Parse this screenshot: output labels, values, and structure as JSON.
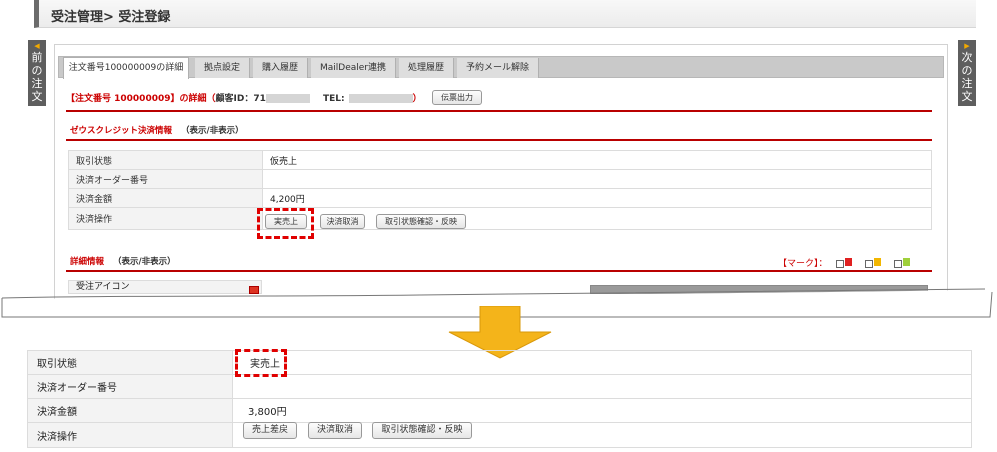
{
  "header": {
    "title": "受注管理> 受注登録"
  },
  "sidenav": {
    "prev": [
      "前",
      "の",
      "注",
      "文"
    ],
    "next": [
      "次",
      "の",
      "注",
      "文"
    ]
  },
  "tabs": [
    {
      "label": "注文番号100000009の詳細",
      "active": true
    },
    {
      "label": "拠点設定"
    },
    {
      "label": "購入履歴"
    },
    {
      "label": "MailDealer連携"
    },
    {
      "label": "処理履歴"
    },
    {
      "label": "予約メール解除"
    }
  ],
  "order": {
    "prefix": "【注文番号 100000009】の詳細（",
    "customer_label": "顧客ID：71",
    "tel_label": "TEL:",
    "suffix": "）",
    "print_button": "伝票出力"
  },
  "zeus": {
    "title": "ゼウスクレジット決済情報",
    "toggle": "（表示/非表示）",
    "rows": [
      {
        "label": "取引状態",
        "value": "仮売上"
      },
      {
        "label": "決済オーダー番号",
        "value": ""
      },
      {
        "label": "決済金額",
        "value": "4,200円"
      },
      {
        "label": "決済操作",
        "value": ""
      }
    ],
    "buttons": [
      "実売上",
      "決済取消",
      "取引状態確認・反映"
    ]
  },
  "detail": {
    "title": "詳細情報",
    "toggle": "（表示/非表示）",
    "mark_label": "【マーク】：",
    "first_row_label": "受注アイコン",
    "flag_colors": [
      "#e02020",
      "#f2b600",
      "#9fd03a"
    ]
  },
  "bottom": {
    "rows": [
      {
        "label": "取引状態",
        "value": "実売上"
      },
      {
        "label": "決済オーダー番号",
        "value": ""
      },
      {
        "label": "決済金額",
        "value": "3,800円"
      },
      {
        "label": "決済操作",
        "value": ""
      }
    ],
    "buttons": [
      "売上差戻",
      "決済取消",
      "取引状態確認・反映"
    ]
  },
  "colors": {
    "accent_red": "#b90000",
    "highlight_dash": "#e00000",
    "arrow": "#f4b41a"
  }
}
